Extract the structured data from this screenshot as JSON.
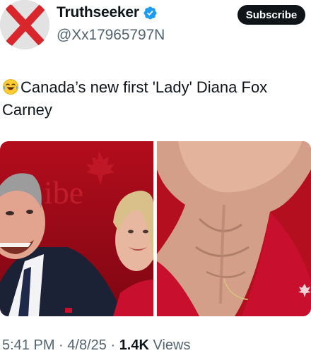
{
  "author": {
    "display_name": "Truthseeker",
    "handle": "@Xx17965797N",
    "verified": true,
    "avatar_icon": "red-x-avatar-icon"
  },
  "actions": {
    "subscribe_label": "Subscribe"
  },
  "tweet": {
    "emoji": "laughing-crying-emoji",
    "text": "Canada’s new first 'Lady' Diana Fox Carney"
  },
  "media": {
    "images": [
      {
        "name": "photo-left",
        "watermark": "ibe"
      },
      {
        "name": "photo-right"
      }
    ]
  },
  "meta": {
    "time": "5:41 PM",
    "separator": "·",
    "date": "4/8/25",
    "views_count": "1.4K",
    "views_label": "Views"
  },
  "colors": {
    "accent_blue": "#1d9bf0",
    "subscribe_bg": "#0f1419",
    "secondary_text": "#536471",
    "photo_red": "#c8102e"
  }
}
